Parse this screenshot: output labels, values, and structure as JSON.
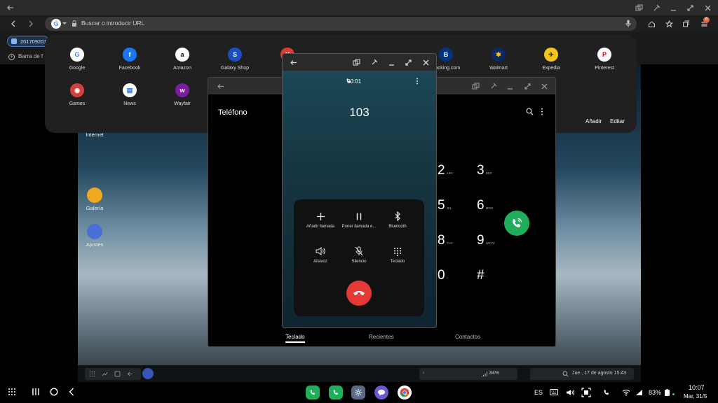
{
  "browser": {
    "url_placeholder": "Buscar o introducir URL",
    "tab_label": "201709201",
    "bookmarks_label": "Barra de f",
    "tab_count": "6"
  },
  "quick_access": [
    {
      "label": "Google",
      "color": "#ffffff",
      "glyph": "G",
      "glyph_color": "#4285f4"
    },
    {
      "label": "Facebook",
      "color": "#1877f2",
      "glyph": "f",
      "glyph_color": "#ffffff"
    },
    {
      "label": "Amazon",
      "color": "#ffffff",
      "glyph": "a",
      "glyph_color": "#111111"
    },
    {
      "label": "Galaxy Shop",
      "color": "#1a4fc0",
      "glyph": "S",
      "glyph_color": "#ffffff"
    },
    {
      "label": "Y",
      "color": "#e53935",
      "glyph": "Y",
      "glyph_color": "#ffffff"
    },
    {
      "label": "",
      "color": "#ffffff",
      "glyph": "",
      "glyph_color": "#1a73e8"
    },
    {
      "label": "",
      "color": "#e91e63",
      "glyph": "",
      "glyph_color": "#ffffff"
    },
    {
      "label": "Booking.com",
      "color": "#003580",
      "glyph": "B",
      "glyph_color": "#ffffff"
    },
    {
      "label": "Walmart",
      "color": "#0a2a66",
      "glyph": "✱",
      "glyph_color": "#ffc220"
    },
    {
      "label": "Expedia",
      "color": "#f5c518",
      "glyph": "✈",
      "glyph_color": "#1a2a4a"
    },
    {
      "label": "Pinterest",
      "color": "#ffffff",
      "glyph": "P",
      "glyph_color": "#e60023"
    },
    {
      "label": "Games",
      "color": "#d43f3f",
      "glyph": "◉",
      "glyph_color": "#ffffff"
    },
    {
      "label": "News",
      "color": "#ffffff",
      "glyph": "▤",
      "glyph_color": "#1a73e8"
    },
    {
      "label": "Wayfair",
      "color": "#7b1fa2",
      "glyph": "w",
      "glyph_color": "#ffffff"
    }
  ],
  "desktop": {
    "icons": [
      {
        "label": "Internet"
      },
      {
        "label": "Galería"
      },
      {
        "label": "Ajustes"
      }
    ]
  },
  "phone_app": {
    "title": "Teléfono",
    "add_label": "Añadir",
    "edit_label": "Editar",
    "keys": [
      {
        "digit": "2",
        "sub": "ABC"
      },
      {
        "digit": "3",
        "sub": "DEF"
      },
      {
        "digit": "5",
        "sub": "JKL"
      },
      {
        "digit": "6",
        "sub": "MNO"
      },
      {
        "digit": "8",
        "sub": "TUV"
      },
      {
        "digit": "9",
        "sub": "WXYZ"
      },
      {
        "digit": "0",
        "sub": "+"
      },
      {
        "digit": "#",
        "sub": ""
      }
    ],
    "tabs": [
      "Teclado",
      "Recientes",
      "Contactos"
    ],
    "accent": "#1fae5a"
  },
  "call": {
    "timer": "00:01",
    "number": "103",
    "buttons": [
      "Añadir llamada",
      "Poner llamada e...",
      "Bluetooth",
      "Altavoz",
      "Silencio",
      "Teclado"
    ],
    "end_color": "#e53935"
  },
  "inner_taskbar": {
    "battery": "84%",
    "datetime": "Jue., 17 de agosto  15:43"
  },
  "system_bar": {
    "language": "ES",
    "battery": "83%",
    "time": "10:07",
    "date": "Mar, 31/5"
  }
}
